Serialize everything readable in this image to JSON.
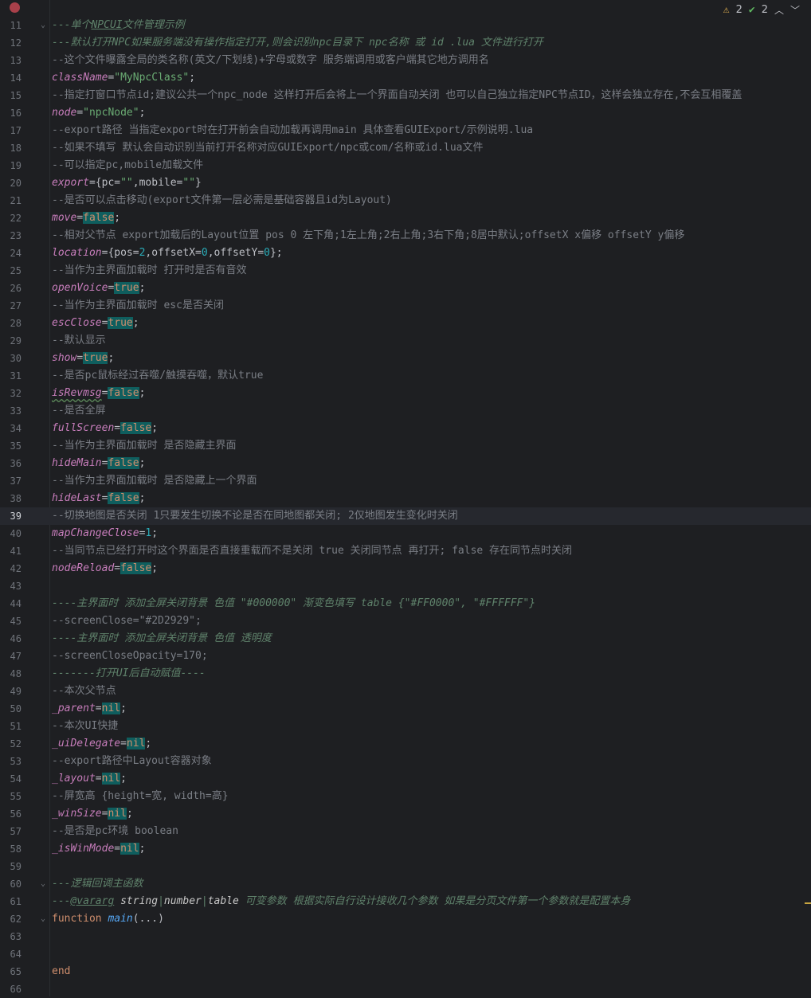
{
  "status": {
    "warnings": "2",
    "weak_warnings": "2"
  },
  "lines": [
    {
      "no": "11",
      "fold": "⌄",
      "tokens": [
        [
          "ci",
          "---单个"
        ],
        [
          "cdtag",
          "NPCUI"
        ],
        [
          "ci",
          "文件管理示例"
        ]
      ]
    },
    {
      "no": "12",
      "tokens": [
        [
          "ci",
          "---默认打开NPC如果服务端没有操作指定打开,则会识别npc目录下 npc名称 或 id .lua 文件进行打开"
        ]
      ]
    },
    {
      "no": "13",
      "tokens": [
        [
          "c",
          "--这个文件曝露全局的类名称(英文/下划线)+字母或数字 服务端调用或客户端其它地方调用名"
        ]
      ]
    },
    {
      "no": "14",
      "tokens": [
        [
          "f",
          "className"
        ],
        [
          "p",
          "="
        ],
        [
          "s",
          "\"MyNpcClass\""
        ],
        [
          "p",
          ";"
        ]
      ]
    },
    {
      "no": "15",
      "tokens": [
        [
          "c",
          "--指定打窗口节点id;建议公共一个npc_node 这样打开后会将上一个界面自动关闭 也可以自己独立指定NPC节点ID，这样会独立存在,不会互相覆盖"
        ]
      ]
    },
    {
      "no": "16",
      "tokens": [
        [
          "f",
          "node"
        ],
        [
          "p",
          "="
        ],
        [
          "s",
          "\"npcNode\""
        ],
        [
          "p",
          ";"
        ]
      ]
    },
    {
      "no": "17",
      "tokens": [
        [
          "c",
          "--export路径 当指定export时在打开前会自动加载再调用main 具体查看GUIExport/示例说明.lua"
        ]
      ]
    },
    {
      "no": "18",
      "tokens": [
        [
          "c",
          "--如果不填写 默认会自动识别当前打开名称对应GUIExport/npc或com/名称或id.lua文件"
        ]
      ]
    },
    {
      "no": "19",
      "tokens": [
        [
          "c",
          "--可以指定pc,mobile加载文件"
        ]
      ]
    },
    {
      "no": "20",
      "tokens": [
        [
          "f",
          "export"
        ],
        [
          "p",
          "={pc="
        ],
        [
          "s",
          "\"\""
        ],
        [
          "p",
          ",mobile="
        ],
        [
          "s",
          "\"\""
        ],
        [
          "p",
          "}"
        ]
      ]
    },
    {
      "no": "21",
      "tokens": [
        [
          "c",
          "--是否可以点击移动(export文件第一层必需是基础容器且id为Layout)"
        ]
      ]
    },
    {
      "no": "22",
      "tokens": [
        [
          "f",
          "move"
        ],
        [
          "p",
          "="
        ],
        [
          "kw",
          "false"
        ],
        [
          "p",
          ";"
        ]
      ]
    },
    {
      "no": "23",
      "tokens": [
        [
          "c",
          "--相对父节点 export加载后的Layout位置 pos 0 左下角;1左上角;2右上角;3右下角;8居中默认;offsetX x偏移 offsetY y偏移"
        ]
      ]
    },
    {
      "no": "24",
      "tokens": [
        [
          "f",
          "location"
        ],
        [
          "p",
          "={pos="
        ],
        [
          "n",
          "2"
        ],
        [
          "p",
          ",offsetX="
        ],
        [
          "n",
          "0"
        ],
        [
          "p",
          ",offsetY="
        ],
        [
          "n",
          "0"
        ],
        [
          "p",
          "};"
        ]
      ]
    },
    {
      "no": "25",
      "tokens": [
        [
          "c",
          "--当作为主界面加载时 打开时是否有音效"
        ]
      ]
    },
    {
      "no": "26",
      "tokens": [
        [
          "f",
          "openVoice"
        ],
        [
          "p",
          "="
        ],
        [
          "kw",
          "true"
        ],
        [
          "p",
          ";"
        ]
      ]
    },
    {
      "no": "27",
      "tokens": [
        [
          "c",
          "--当作为主界面加载时 esc是否关闭"
        ]
      ]
    },
    {
      "no": "28",
      "tokens": [
        [
          "f",
          "escClose"
        ],
        [
          "p",
          "="
        ],
        [
          "kw",
          "true"
        ],
        [
          "p",
          ";"
        ]
      ]
    },
    {
      "no": "29",
      "tokens": [
        [
          "c",
          "--默认显示"
        ]
      ]
    },
    {
      "no": "30",
      "tokens": [
        [
          "f",
          "show"
        ],
        [
          "p",
          "="
        ],
        [
          "kw",
          "true"
        ],
        [
          "p",
          ";"
        ]
      ]
    },
    {
      "no": "31",
      "tokens": [
        [
          "c",
          "--是否pc鼠标经过吞噬/触摸吞噬，默认true"
        ]
      ]
    },
    {
      "no": "32",
      "tokens": [
        [
          "fsq",
          "isRevmsg"
        ],
        [
          "p",
          "="
        ],
        [
          "kw",
          "false"
        ],
        [
          "p",
          ";"
        ]
      ]
    },
    {
      "no": "33",
      "tokens": [
        [
          "c",
          "--是否全屏"
        ]
      ]
    },
    {
      "no": "34",
      "tokens": [
        [
          "f",
          "fullScreen"
        ],
        [
          "p",
          "="
        ],
        [
          "kw",
          "false"
        ],
        [
          "p",
          ";"
        ]
      ]
    },
    {
      "no": "35",
      "tokens": [
        [
          "c",
          "--当作为主界面加载时 是否隐藏主界面"
        ]
      ]
    },
    {
      "no": "36",
      "tokens": [
        [
          "f",
          "hideMain"
        ],
        [
          "p",
          "="
        ],
        [
          "kw",
          "false"
        ],
        [
          "p",
          ";"
        ]
      ]
    },
    {
      "no": "37",
      "tokens": [
        [
          "c",
          "--当作为主界面加载时 是否隐藏上一个界面"
        ]
      ]
    },
    {
      "no": "38",
      "tokens": [
        [
          "f",
          "hideLast"
        ],
        [
          "p",
          "="
        ],
        [
          "kw",
          "false"
        ],
        [
          "p",
          ";"
        ]
      ]
    },
    {
      "no": "39",
      "current": true,
      "tokens": [
        [
          "c",
          "--切换地图是否关闭 1只要发生切换不论是否在同地图都关闭; 2仅地图发生变化时关闭"
        ]
      ]
    },
    {
      "no": "40",
      "tokens": [
        [
          "f",
          "mapChangeClose"
        ],
        [
          "p",
          "="
        ],
        [
          "n",
          "1"
        ],
        [
          "p",
          ";"
        ]
      ]
    },
    {
      "no": "41",
      "tokens": [
        [
          "c",
          "--当同节点已经打开时这个界面是否直接重载而不是关闭 true 关闭同节点 再打开; false 存在同节点时关闭"
        ]
      ]
    },
    {
      "no": "42",
      "tokens": [
        [
          "f",
          "nodeReload"
        ],
        [
          "p",
          "="
        ],
        [
          "kw",
          "false"
        ],
        [
          "p",
          ";"
        ]
      ]
    },
    {
      "no": "43",
      "tokens": []
    },
    {
      "no": "44",
      "tokens": [
        [
          "ci",
          "----主界面时 添加全屏关闭背景 色值 \"#000000\" 渐变色填写 table {\"#FF0000\", \"#FFFFFF\"}"
        ]
      ]
    },
    {
      "no": "45",
      "tokens": [
        [
          "c",
          "--screenClose=\"#2D2929\";"
        ]
      ]
    },
    {
      "no": "46",
      "tokens": [
        [
          "ci",
          "----主界面时 添加全屏关闭背景 色值 透明度"
        ]
      ]
    },
    {
      "no": "47",
      "tokens": [
        [
          "c",
          "--screenCloseOpacity=170;"
        ]
      ]
    },
    {
      "no": "48",
      "tokens": [
        [
          "ci",
          "-------打开UI后自动赋值----"
        ]
      ]
    },
    {
      "no": "49",
      "tokens": [
        [
          "c",
          "--本次父节点"
        ]
      ]
    },
    {
      "no": "50",
      "tokens": [
        [
          "f",
          "_parent"
        ],
        [
          "p",
          "="
        ],
        [
          "kn",
          "nil"
        ],
        [
          "p",
          ";"
        ]
      ]
    },
    {
      "no": "51",
      "tokens": [
        [
          "c",
          "--本次UI快捷"
        ]
      ]
    },
    {
      "no": "52",
      "tokens": [
        [
          "f",
          "_uiDelegate"
        ],
        [
          "p",
          "="
        ],
        [
          "kn",
          "nil"
        ],
        [
          "p",
          ";"
        ]
      ]
    },
    {
      "no": "53",
      "tokens": [
        [
          "c",
          "--export路径中Layout容器对象"
        ]
      ]
    },
    {
      "no": "54",
      "tokens": [
        [
          "f",
          "_layout"
        ],
        [
          "p",
          "="
        ],
        [
          "kn",
          "nil"
        ],
        [
          "p",
          ";"
        ]
      ]
    },
    {
      "no": "55",
      "tokens": [
        [
          "c",
          "--屏宽高 {height=宽, width=高}"
        ]
      ]
    },
    {
      "no": "56",
      "tokens": [
        [
          "f",
          "_winSize"
        ],
        [
          "p",
          "="
        ],
        [
          "kn",
          "nil"
        ],
        [
          "p",
          ";"
        ]
      ]
    },
    {
      "no": "57",
      "tokens": [
        [
          "c",
          "--是否是pc环境 boolean"
        ]
      ]
    },
    {
      "no": "58",
      "tokens": [
        [
          "f",
          "_isWinMode"
        ],
        [
          "p",
          "="
        ],
        [
          "kn",
          "nil"
        ],
        [
          "p",
          ";"
        ]
      ]
    },
    {
      "no": "59",
      "tokens": []
    },
    {
      "no": "60",
      "fold": "⌄",
      "tokens": [
        [
          "ci",
          "---逻辑回调主函数"
        ]
      ]
    },
    {
      "no": "61",
      "tokens": [
        [
          "ci",
          "---"
        ],
        [
          "cdtag",
          "@vararg"
        ],
        [
          "p",
          " "
        ],
        [
          "ty",
          "string"
        ],
        [
          "pu",
          "|"
        ],
        [
          "ty",
          "number"
        ],
        [
          "pu",
          "|"
        ],
        [
          "ty",
          "table"
        ],
        [
          "ci",
          " 可变参数 根据实际自行设计接收几个参数 如果是分页文件第一个参数就是配置本身"
        ]
      ]
    },
    {
      "no": "62",
      "fold": "⌄",
      "tokens": [
        [
          "k",
          "function"
        ],
        [
          "p",
          " "
        ],
        [
          "fn",
          "main"
        ],
        [
          "p",
          "(...)"
        ]
      ]
    },
    {
      "no": "63",
      "tokens": []
    },
    {
      "no": "64",
      "tokens": []
    },
    {
      "no": "65",
      "tokens": [
        [
          "k",
          "end"
        ]
      ]
    },
    {
      "no": "66",
      "tokens": []
    }
  ]
}
